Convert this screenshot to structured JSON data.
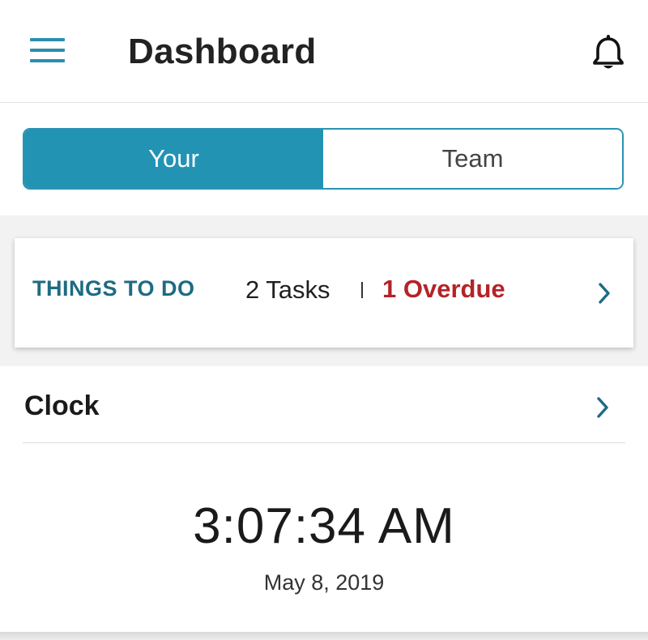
{
  "header": {
    "title": "Dashboard",
    "menu_icon": "hamburger-menu-icon",
    "notification_icon": "bell-icon"
  },
  "tabs": [
    {
      "label": "Your",
      "selected": true
    },
    {
      "label": "Team",
      "selected": false
    }
  ],
  "things_to_do": {
    "title": "THINGS TO DO",
    "tasks": "2 Tasks",
    "separator": "|",
    "overdue": "1 Overdue"
  },
  "clock": {
    "title": "Clock",
    "time": "3:07:34 AM",
    "date": "May 8, 2019"
  },
  "colors": {
    "accent": "#2393b4",
    "title_teal": "#1d6b82",
    "overdue_red": "#b42328"
  }
}
